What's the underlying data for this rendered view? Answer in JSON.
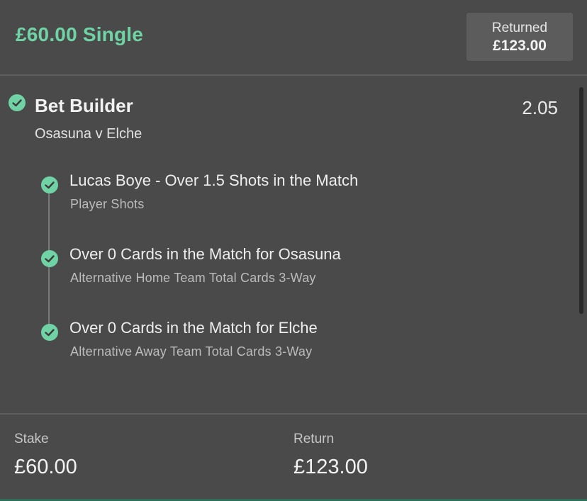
{
  "header": {
    "bet_title": "£60.00 Single",
    "returned_label": "Returned",
    "returned_amount": "£123.00"
  },
  "bet_builder": {
    "title": "Bet Builder",
    "odds": "2.05",
    "match": "Osasuna v Elche",
    "status_icon": "check-circle-icon",
    "legs": [
      {
        "title": "Lucas Boye - Over 1.5 Shots in the Match",
        "market": "Player Shots"
      },
      {
        "title": "Over 0 Cards in the Match for Osasuna",
        "market": "Alternative Home Team Total Cards 3-Way"
      },
      {
        "title": "Over 0 Cards in the Match for Elche",
        "market": "Alternative Away Team Total Cards 3-Way"
      }
    ]
  },
  "footer": {
    "stake_label": "Stake",
    "stake_value": "£60.00",
    "return_label": "Return",
    "return_value": "£123.00"
  },
  "colors": {
    "background": "#4a4a4a",
    "accent_green": "#6fd3a5",
    "returned_box": "#5c5c5c"
  }
}
